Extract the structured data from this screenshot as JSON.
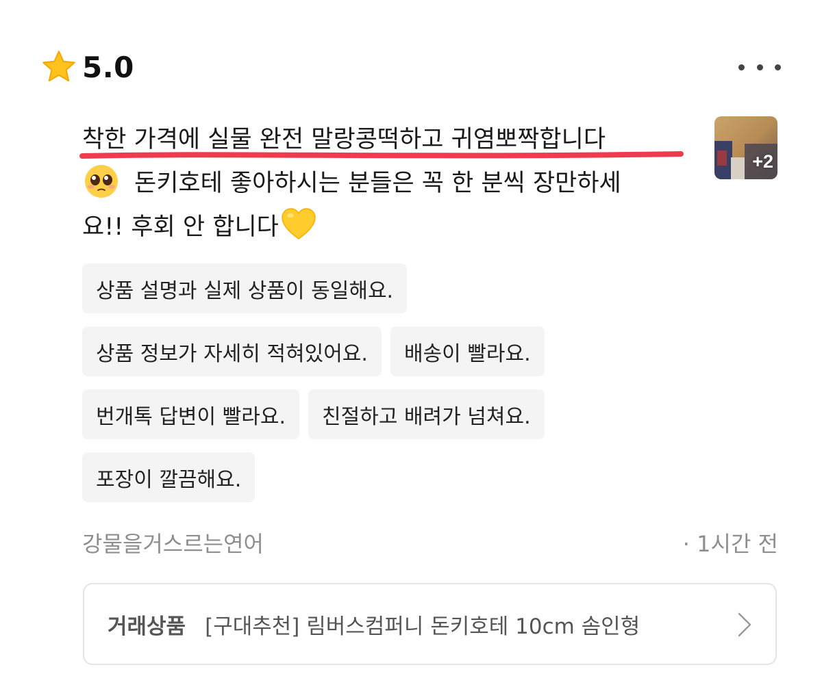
{
  "rating": {
    "value": "5.0",
    "star_icon": "star-icon",
    "star_color": "#FFC21F"
  },
  "more_icon": "more-horizontal-icon",
  "review": {
    "line1": "착한 가격에 실물 완전 말랑콩떡하고 귀염뽀짝합니다",
    "line2": "돈키호테 좋아하시는 분들은 꼭 한 분씩 장만하세",
    "line3": "요!! 후회 안 합니다",
    "highlight_color": "#EE3B4E"
  },
  "photos": {
    "extra_count_label": "+2"
  },
  "tags": [
    [
      "상품 설명과 실제 상품이 동일해요."
    ],
    [
      "상품 정보가 자세히 적혀있어요.",
      "배송이 빨라요."
    ],
    [
      "번개톡 답변이 빨라요.",
      "친절하고 배려가 넘쳐요."
    ],
    [
      "포장이 깔끔해요."
    ]
  ],
  "meta": {
    "author": "강물을거스르는연어",
    "time": "· 1시간 전"
  },
  "trade": {
    "label": "거래상품",
    "product": "[구대추천] 림버스컴퍼니 돈키호테 10cm 솜인형"
  }
}
